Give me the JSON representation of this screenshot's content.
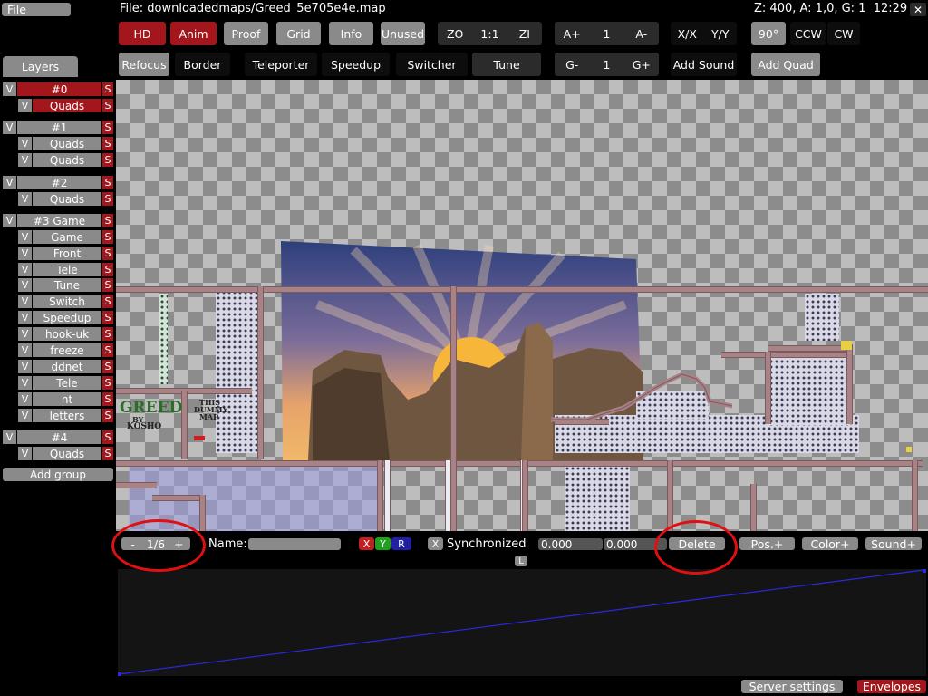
{
  "menu": {
    "file_label": "File",
    "file_path": "File: downloadedmaps/Greed_5e705e4e.map",
    "status": "Z: 400, A: 1,0, G: 1  12:29"
  },
  "toolbar": {
    "hd": "HD",
    "anim": "Anim",
    "proof": "Proof",
    "grid": "Grid",
    "info": "Info",
    "unused": "Unused",
    "zoom": {
      "out": "ZO",
      "reset": "1:1",
      "in": "ZI"
    },
    "anim_speed": {
      "up": "A+",
      "value": "1",
      "down": "A-"
    },
    "flip_x": "X/X",
    "flip_y": "Y/Y",
    "rotate_angle": "90°",
    "ccw": "CCW",
    "cw": "CW",
    "refocus": "Refocus",
    "border": "Border",
    "teleporter": "Teleporter",
    "speedup": "Speedup",
    "switcher": "Switcher",
    "tune": "Tune",
    "grid_factor": {
      "down": "G-",
      "value": "1",
      "up": "G+"
    },
    "add_sound": "Add Sound",
    "add_quad": "Add Quad"
  },
  "layers": {
    "title": "Layers",
    "visible_toggle": "V",
    "solo_toggle": "S",
    "groups": [
      {
        "name": "#0",
        "layers": [
          "Quads"
        ]
      },
      {
        "name": "#1",
        "layers": [
          "Quads",
          "Quads"
        ]
      },
      {
        "name": "#2",
        "layers": [
          "Quads"
        ]
      },
      {
        "name": "#3 Game",
        "layers": [
          "Game",
          "Front",
          "Tele",
          "Tune",
          "Switch",
          "Speedup",
          "hook-uk",
          "freeze",
          "ddnet",
          "Tele",
          "ht",
          "letters"
        ]
      },
      {
        "name": "#4",
        "layers": [
          "Quads"
        ]
      }
    ],
    "add_group": "Add group"
  },
  "map_text": {
    "logo_line1": "GREED",
    "logo_line2": "BY",
    "logo_line3": "KOSHO",
    "sign_line1": "THIS",
    "sign_line2": "DUMMY",
    "sign_line3": "MAP"
  },
  "envelope": {
    "prev": "-",
    "index": "1/6",
    "next": "+",
    "name_label": "Name:",
    "name_value": "",
    "channel_r": "X",
    "channel_g": "Y",
    "channel_b": "R",
    "sync_toggle": "X",
    "sync_label": "Synchronized",
    "time_value": "0.000",
    "curve_value": "0.000",
    "delete": "Delete",
    "pos_add": "Pos.+",
    "color_add": "Color+",
    "sound_add": "Sound+",
    "lock": "L"
  },
  "bottom": {
    "server_settings": "Server settings",
    "envelopes": "Envelopes"
  },
  "colors": {
    "accent_red": "#a3171c",
    "button_gray": "#8a8a8a",
    "highlight_circle": "#e01010",
    "curve_blue": "#2a2ae0"
  }
}
